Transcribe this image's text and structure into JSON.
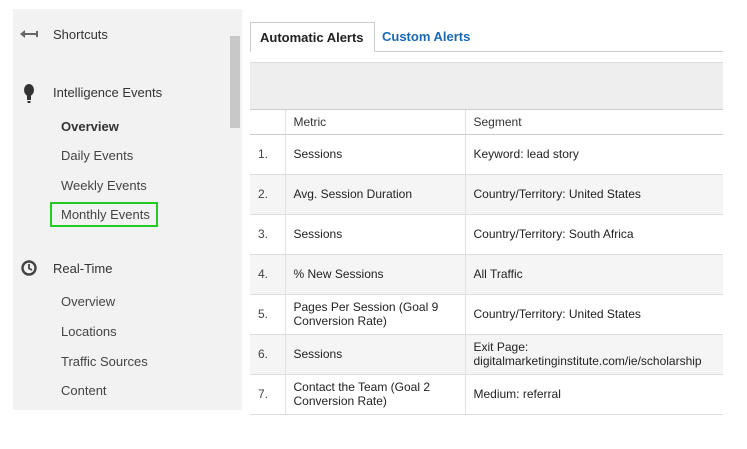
{
  "sidebar": {
    "shortcuts": {
      "label": "Shortcuts",
      "icon": "shortcuts-arrow-icon"
    },
    "intelligence": {
      "label": "Intelligence Events",
      "icon": "lightbulb-icon",
      "items": [
        {
          "label": "Overview",
          "active": true
        },
        {
          "label": "Daily Events"
        },
        {
          "label": "Weekly Events"
        },
        {
          "label": "Monthly Events",
          "highlighted": true
        }
      ]
    },
    "realtime": {
      "label": "Real-Time",
      "icon": "clock-icon",
      "items": [
        {
          "label": "Overview"
        },
        {
          "label": "Locations"
        },
        {
          "label": "Traffic Sources"
        },
        {
          "label": "Content"
        }
      ]
    },
    "highlight_color": "#22cc22"
  },
  "tabs": [
    {
      "label": "Automatic Alerts",
      "active": true
    },
    {
      "label": "Custom Alerts",
      "active": false,
      "color": "#1a6ab3"
    }
  ],
  "table": {
    "columns": [
      "",
      "Metric",
      "Segment"
    ],
    "rows": [
      {
        "num": "1.",
        "metric": "Sessions",
        "segment": "Keyword: lead story"
      },
      {
        "num": "2.",
        "metric": "Avg. Session Duration",
        "segment": "Country/Territory: United States"
      },
      {
        "num": "3.",
        "metric": "Sessions",
        "segment": "Country/Territory: South Africa"
      },
      {
        "num": "4.",
        "metric": "% New Sessions",
        "segment": "All Traffic"
      },
      {
        "num": "5.",
        "metric": "Pages Per Session (Goal 9 Conversion Rate)",
        "segment": "Country/Territory: United States"
      },
      {
        "num": "6.",
        "metric": "Sessions",
        "segment": "Exit Page: digitalmarketinginstitute.com/ie/scholarship"
      },
      {
        "num": "7.",
        "metric": "Contact the Team (Goal 2 Conversion Rate)",
        "segment": "Medium: referral"
      }
    ]
  }
}
